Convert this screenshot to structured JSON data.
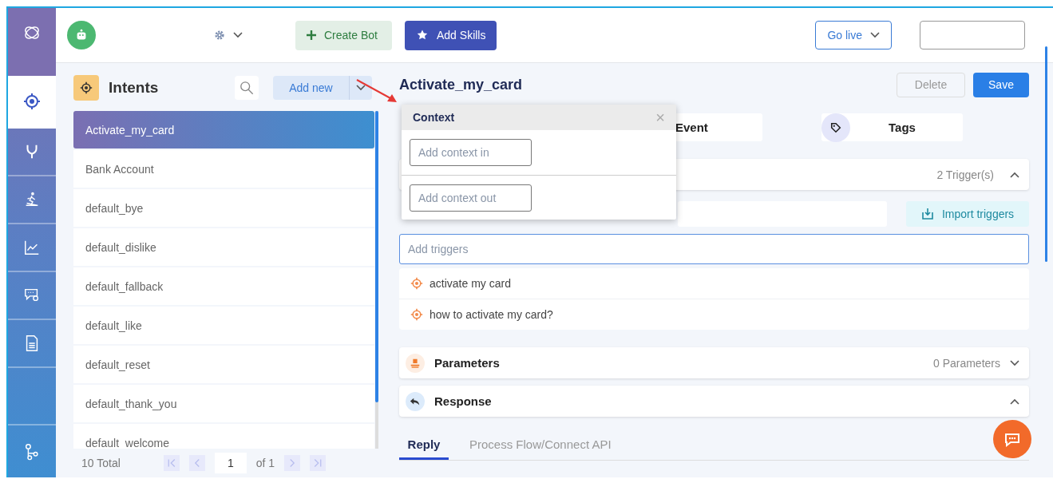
{
  "rail": [
    {
      "kind": "logo",
      "selected": false
    },
    {
      "kind": "target",
      "selected": true
    },
    {
      "kind": "branch",
      "selected": false
    },
    {
      "kind": "runner",
      "selected": false
    },
    {
      "kind": "chart",
      "selected": false
    },
    {
      "kind": "chat-gear",
      "selected": false
    },
    {
      "kind": "document",
      "selected": false
    },
    {
      "kind": "empty",
      "selected": false
    },
    {
      "kind": "nodes",
      "selected": false
    }
  ],
  "topbar": {
    "create_bot": "Create Bot",
    "add_skills": "Add Skills",
    "go_live": "Go live"
  },
  "intents": {
    "title": "Intents",
    "add_new": "Add new",
    "items": [
      {
        "label": "Activate_my_card",
        "selected": true
      },
      {
        "label": "Bank Account",
        "selected": false
      },
      {
        "label": "default_bye",
        "selected": false
      },
      {
        "label": "default_dislike",
        "selected": false
      },
      {
        "label": "default_fallback",
        "selected": false
      },
      {
        "label": "default_like",
        "selected": false
      },
      {
        "label": "default_reset",
        "selected": false
      },
      {
        "label": "default_thank_you",
        "selected": false
      },
      {
        "label": "default_welcome",
        "selected": false
      }
    ],
    "pager": {
      "total": "10 Total",
      "page": "1",
      "of": "of 1"
    }
  },
  "detail": {
    "title": "Activate_my_card",
    "delete": "Delete",
    "save": "Save",
    "tabs": [
      {
        "label": "Event",
        "kind": "plain"
      },
      {
        "label": "Tags",
        "kind": "tag"
      }
    ],
    "context_popup": {
      "title": "Context",
      "close": "×",
      "in_placeholder": "Add context in",
      "out_placeholder": "Add context out"
    },
    "triggers": {
      "count": "2 Trigger(s)",
      "expanded": true,
      "import": "Import triggers",
      "placeholder": "Add triggers",
      "items": [
        "activate my card",
        "how to activate my card?"
      ]
    },
    "sections": [
      {
        "kind": "parameters",
        "title": "Parameters",
        "count": "0 Parameters",
        "expanded": false
      },
      {
        "kind": "response",
        "title": "Response",
        "expanded": true
      }
    ],
    "reply_tabs": [
      {
        "label": "Reply",
        "selected": true
      },
      {
        "label": "Process Flow/Connect API",
        "selected": false
      }
    ]
  }
}
